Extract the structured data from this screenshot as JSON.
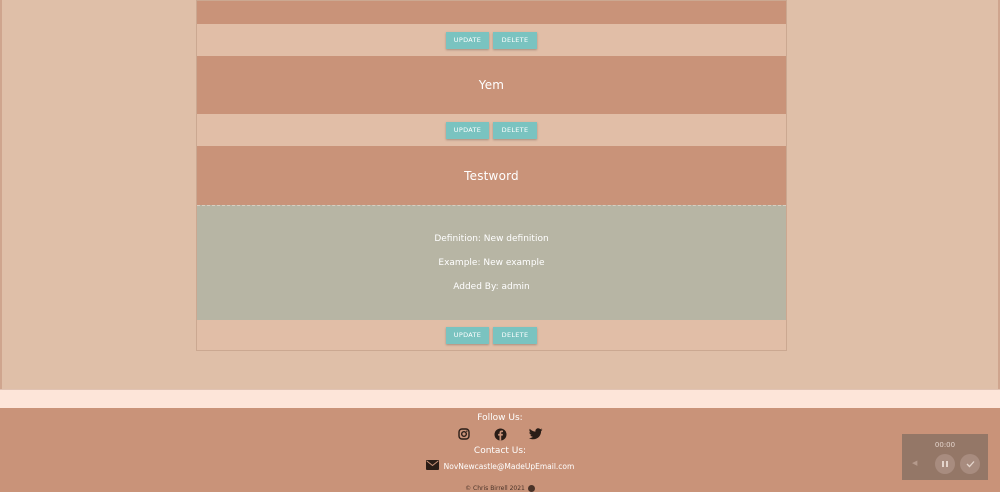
{
  "cards": [
    {
      "word": "",
      "buttons": {
        "update": "UPDATE",
        "delete": "DELETE"
      }
    },
    {
      "word": "Yem",
      "buttons": {
        "update": "UPDATE",
        "delete": "DELETE"
      }
    },
    {
      "word": "Testword",
      "buttons": {
        "update": "UPDATE",
        "delete": "DELETE"
      },
      "definition": "Definition: New definition",
      "example": "Example: New example",
      "added_by": "Added By: admin"
    }
  ],
  "footer": {
    "follow_label": "Follow Us:",
    "social_icons": [
      "instagram-icon",
      "facebook-icon",
      "twitter-icon"
    ],
    "contact_label": "Contact Us:",
    "email": "NovNewcastle@MadeUpEmail.com",
    "copyright": "© Chris Birrell 2021"
  },
  "recorder": {
    "time": "00:00"
  },
  "colors": {
    "card_header": "#c99379",
    "button": "#7ac3c0",
    "detail_panel": "#b7b5a4",
    "footer": "#c99379"
  }
}
